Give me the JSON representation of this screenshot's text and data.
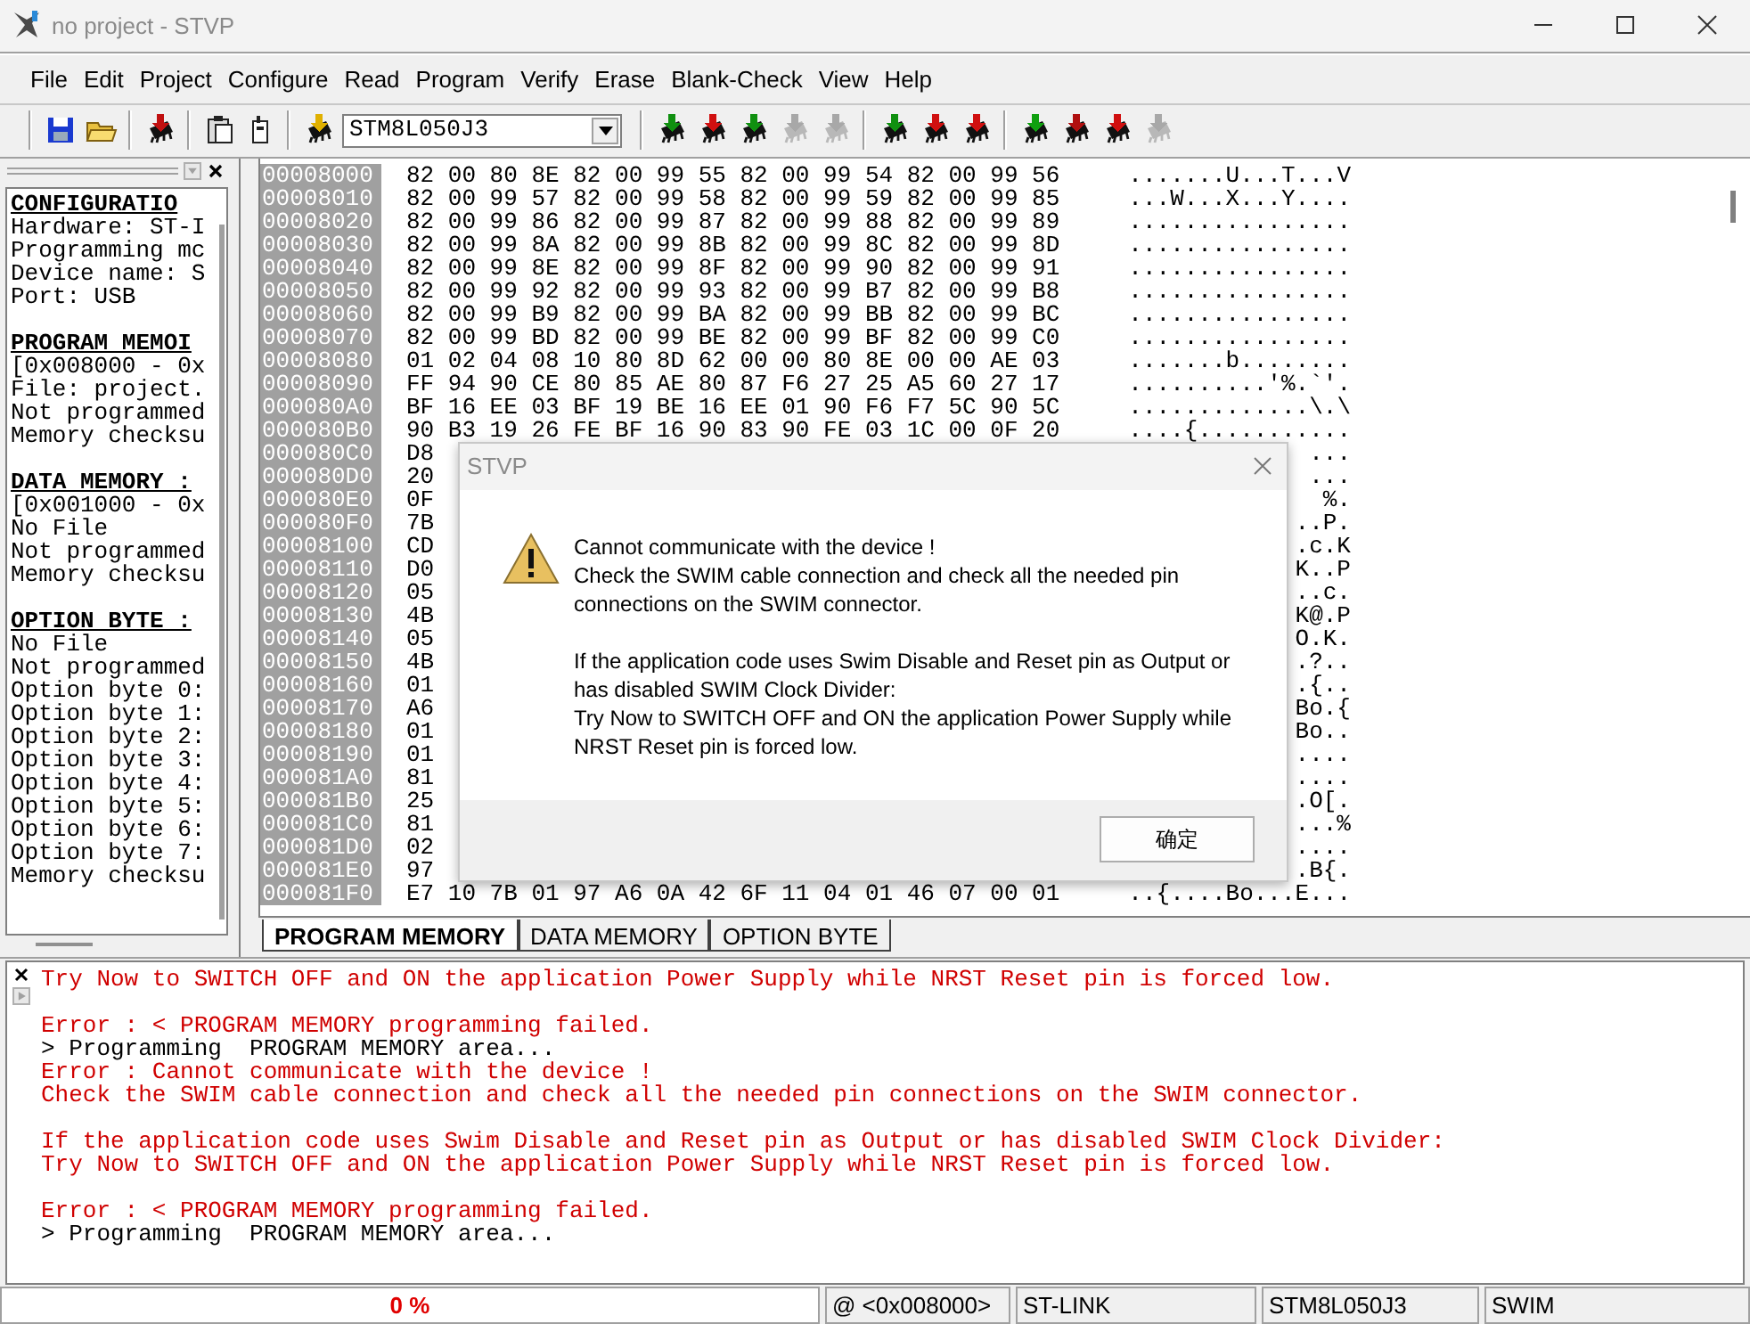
{
  "window": {
    "title": "no project - STVP"
  },
  "menu": [
    "File",
    "Edit",
    "Project",
    "Configure",
    "Read",
    "Program",
    "Verify",
    "Erase",
    "Blank-Check",
    "View",
    "Help"
  ],
  "toolbar": [
    [
      {
        "kind": "save"
      },
      {
        "kind": "open"
      }
    ],
    [
      {
        "kind": "chip",
        "color": "#c01010"
      }
    ],
    [
      {
        "kind": "paste"
      },
      {
        "kind": "device"
      }
    ],
    [
      {
        "kind": "chip",
        "color": "#e0b000"
      },
      {
        "kind": "combo",
        "value": "STM8L050J3"
      }
    ],
    [
      {
        "kind": "chip",
        "color": "#109010"
      },
      {
        "kind": "chip",
        "color": "#d01010"
      },
      {
        "kind": "chip",
        "color": "#109010"
      },
      {
        "kind": "chip",
        "color": "#a8a8a8"
      },
      {
        "kind": "chip",
        "color": "#a8a8a8"
      }
    ],
    [
      {
        "kind": "chip",
        "color": "#109010"
      },
      {
        "kind": "chip",
        "color": "#d01010"
      },
      {
        "kind": "chip",
        "color": "#d01010"
      }
    ],
    [
      {
        "kind": "chip",
        "color": "#10a010"
      },
      {
        "kind": "chip",
        "color": "#b01010"
      },
      {
        "kind": "chip",
        "color": "#d01010"
      },
      {
        "kind": "chip",
        "color": "#a8a8a8"
      }
    ]
  ],
  "info_panel": {
    "sections": [
      {
        "heading": "CONFIGURATIO",
        "lines": [
          "Hardware: ST-I",
          "Programming mc",
          "Device name: S",
          "Port: USB"
        ]
      },
      {
        "heading": "PROGRAM MEMOI",
        "lines": [
          "[0x008000 - 0x",
          "File: project.",
          "Not programmed",
          "Memory checksu"
        ]
      },
      {
        "heading": "DATA MEMORY :",
        "lines": [
          "[0x001000 - 0x",
          "No File",
          "Not programmed",
          "Memory checksu"
        ]
      },
      {
        "heading": "OPTION BYTE :",
        "lines": [
          "No File",
          "Not programmed",
          "Option byte 0:",
          "Option byte 1:",
          "Option byte 2:",
          "Option byte 3:",
          "Option byte 4:",
          "Option byte 5:",
          "Option byte 6:",
          "Option byte 7:",
          "Memory checksu"
        ]
      }
    ]
  },
  "hex_view": {
    "rows": [
      {
        "address": "00008000",
        "hex": "82 00 80 8E 82 00 99 55 82 00 99 54 82 00 99 56",
        "ascii": ".......U...T...V"
      },
      {
        "address": "00008010",
        "hex": "82 00 99 57 82 00 99 58 82 00 99 59 82 00 99 85",
        "ascii": "...W...X...Y...."
      },
      {
        "address": "00008020",
        "hex": "82 00 99 86 82 00 99 87 82 00 99 88 82 00 99 89",
        "ascii": "................"
      },
      {
        "address": "00008030",
        "hex": "82 00 99 8A 82 00 99 8B 82 00 99 8C 82 00 99 8D",
        "ascii": "................"
      },
      {
        "address": "00008040",
        "hex": "82 00 99 8E 82 00 99 8F 82 00 99 90 82 00 99 91",
        "ascii": "................"
      },
      {
        "address": "00008050",
        "hex": "82 00 99 92 82 00 99 93 82 00 99 B7 82 00 99 B8",
        "ascii": "................"
      },
      {
        "address": "00008060",
        "hex": "82 00 99 B9 82 00 99 BA 82 00 99 BB 82 00 99 BC",
        "ascii": "................"
      },
      {
        "address": "00008070",
        "hex": "82 00 99 BD 82 00 99 BE 82 00 99 BF 82 00 99 C0",
        "ascii": "................"
      },
      {
        "address": "00008080",
        "hex": "01 02 04 08 10 80 8D 62 00 00 80 8E 00 00 AE 03",
        "ascii": ".......b........"
      },
      {
        "address": "00008090",
        "hex": "FF 94 90 CE 80 85 AE 80 87 F6 27 25 A5 60 27 17",
        "ascii": "..........'%.`'."
      },
      {
        "address": "000080A0",
        "hex": "BF 16 EE 03 BF 19 BE 16 EE 01 90 F6 F7 5C 90 5C",
        "ascii": ".............\\.\\"
      },
      {
        "address": "000080B0",
        "hex": "90 B3 19 26 FE BF 16 90 83 90 FE 03 1C 00 0F 20",
        "ascii": "....{..........."
      },
      {
        "address": "000080C0",
        "hex": "D8",
        "ascii": "..."
      },
      {
        "address": "000080D0",
        "hex": "20",
        "ascii": "..."
      },
      {
        "address": "000080E0",
        "hex": "0F",
        "ascii": "%."
      },
      {
        "address": "000080F0",
        "hex": "7B",
        "ascii": "..P."
      },
      {
        "address": "00008100",
        "hex": "CD",
        "ascii": ".c.K"
      },
      {
        "address": "00008110",
        "hex": "D0",
        "ascii": "K..P"
      },
      {
        "address": "00008120",
        "hex": "05",
        "ascii": "..c."
      },
      {
        "address": "00008130",
        "hex": "4B",
        "ascii": "K@.P"
      },
      {
        "address": "00008140",
        "hex": "05",
        "ascii": "O.K."
      },
      {
        "address": "00008150",
        "hex": "4B",
        "ascii": ".?.."
      },
      {
        "address": "00008160",
        "hex": "01",
        "ascii": ".{.."
      },
      {
        "address": "00008170",
        "hex": "A6",
        "ascii": "Bo.{"
      },
      {
        "address": "00008180",
        "hex": "01",
        "ascii": "Bo.."
      },
      {
        "address": "00008190",
        "hex": "01",
        "ascii": "...."
      },
      {
        "address": "000081A0",
        "hex": "81",
        "ascii": "...."
      },
      {
        "address": "000081B0",
        "hex": "25",
        "ascii": ".O[."
      },
      {
        "address": "000081C0",
        "hex": "81",
        "ascii": "...%"
      },
      {
        "address": "000081D0",
        "hex": "02",
        "ascii": "...."
      },
      {
        "address": "000081E0",
        "hex": "97",
        "ascii": ".B{."
      },
      {
        "address": "000081F0",
        "hex": "E7 10 7B 01 97 A6 0A 42 6F 11 04 01 46 07 00 01",
        "ascii": "..{....Bo...E..."
      }
    ]
  },
  "tabs": [
    {
      "label": "PROGRAM MEMORY",
      "selected": true
    },
    {
      "label": "DATA MEMORY",
      "selected": false
    },
    {
      "label": "OPTION BYTE",
      "selected": false
    }
  ],
  "dialog": {
    "title": "STVP",
    "paragraphs": [
      "Cannot communicate with the device !\nCheck the SWIM cable connection and check all the needed pin\nconnections on the SWIM connector.",
      "If the application code uses Swim Disable and Reset pin as Output or\nhas disabled SWIM Clock Divider:\nTry Now to SWITCH OFF and ON the application Power Supply while\nNRST Reset pin is forced low."
    ],
    "button": "确定"
  },
  "log": [
    [
      {
        "kind": "error",
        "text": "Try Now to SWITCH OFF and ON the application Power Supply while NRST Reset pin is forced low."
      }
    ],
    [
      {
        "kind": "error",
        "text": "Error : < PROGRAM MEMORY programming failed."
      },
      {
        "kind": "info",
        "text": "> Programming  PROGRAM MEMORY area..."
      },
      {
        "kind": "error",
        "text": "Error : Cannot communicate with the device !"
      },
      {
        "kind": "error",
        "text": "Check the SWIM cable connection and check all the needed pin connections on the SWIM connector."
      }
    ],
    [
      {
        "kind": "error",
        "text": "If the application code uses Swim Disable and Reset pin as Output or has disabled SWIM Clock Divider:"
      },
      {
        "kind": "error",
        "text": "Try Now to SWITCH OFF and ON the application Power Supply while NRST Reset pin is forced low."
      }
    ],
    [
      {
        "kind": "error",
        "text": "Error : < PROGRAM MEMORY programming failed."
      },
      {
        "kind": "info",
        "text": "> Programming  PROGRAM MEMORY area..."
      }
    ]
  ],
  "status_bar": {
    "progress": {
      "text": "0 %",
      "level": 0
    },
    "fields": [
      "@ <0x008000>",
      "ST-LINK",
      "STM8L050J3",
      "SWIM"
    ]
  }
}
